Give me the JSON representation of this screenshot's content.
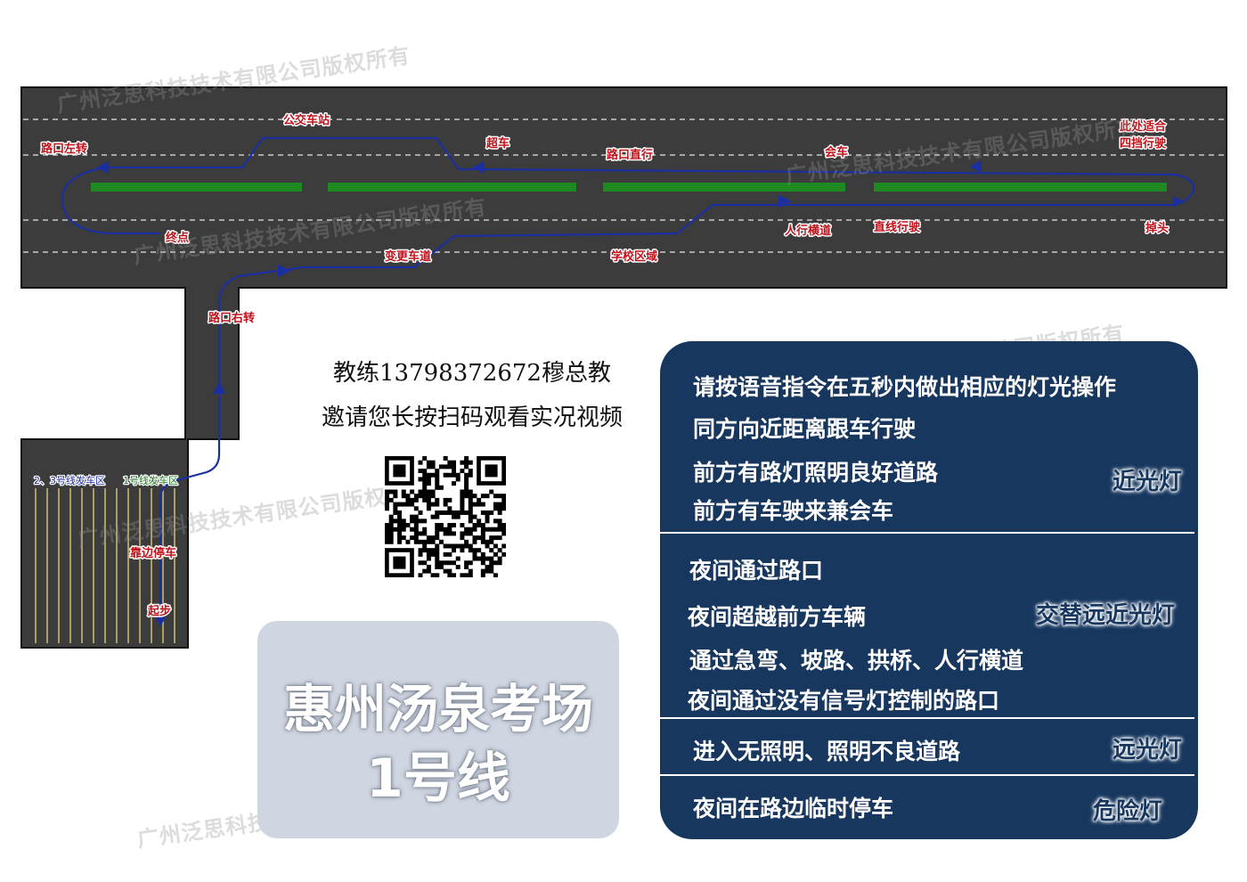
{
  "map": {
    "road_labels": [
      {
        "id": "bus-stop",
        "text": "公交车站"
      },
      {
        "id": "overtake",
        "text": "超车"
      },
      {
        "id": "straight-intersection",
        "text": "路口直行"
      },
      {
        "id": "meet",
        "text": "会车"
      },
      {
        "id": "fourth-gear-1",
        "text": "此处适合"
      },
      {
        "id": "fourth-gear-2",
        "text": "四挡行驶"
      },
      {
        "id": "left-turn",
        "text": "路口左转"
      },
      {
        "id": "end",
        "text": "终点"
      },
      {
        "id": "lane-change",
        "text": "变更车道"
      },
      {
        "id": "school-zone",
        "text": "学校区域"
      },
      {
        "id": "crosswalk",
        "text": "人行横道"
      },
      {
        "id": "straight-drive",
        "text": "直线行驶"
      },
      {
        "id": "u-turn",
        "text": "掉头"
      },
      {
        "id": "right-turn",
        "text": "路口右转"
      },
      {
        "id": "pull-over",
        "text": "靠边停车"
      },
      {
        "id": "start",
        "text": "起步"
      }
    ],
    "zone_labels": {
      "lines_23": "2、3号线发车区",
      "line_1": "1号线发车区"
    },
    "colors": {
      "road": "#3c3c3c",
      "median": "#1f8a22",
      "route": "#1c2fa0",
      "label": "#c0121b",
      "panel": "#17375f"
    }
  },
  "watermark": "广州泛思科技技术有限公司版权所有",
  "coach": {
    "line1": "教练13798372672穆总教",
    "line2": "邀请您长按扫码观看实况视频"
  },
  "title_card": {
    "line1": "惠州汤泉考场",
    "line2": "1号线"
  },
  "light_panel": {
    "groups": [
      {
        "light": "近光灯",
        "items": [
          "请按语音指令在五秒内做出相应的灯光操作",
          "同方向近距离跟车行驶",
          "前方有路灯照明良好道路",
          "前方有车驶来兼会车"
        ]
      },
      {
        "light": "交替远近光灯",
        "items": [
          "夜间通过路口",
          "夜间超越前方车辆",
          "通过急弯、坡路、拱桥、人行横道",
          "夜间通过没有信号灯控制的路口"
        ]
      },
      {
        "light": "远光灯",
        "items": [
          "进入无照明、照明不良道路"
        ]
      },
      {
        "light": "危险灯",
        "items": [
          "夜间在路边临时停车"
        ]
      }
    ]
  }
}
